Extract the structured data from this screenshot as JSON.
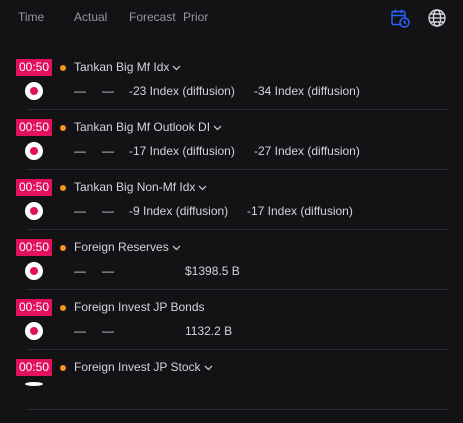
{
  "header": {
    "time": "Time",
    "actual": "Actual",
    "forecast": "Forecast",
    "prior": "Prior",
    "icons": [
      "calendar-clock-icon",
      "globe-icon"
    ],
    "accent": "#2962ff"
  },
  "colors": {
    "time_badge": "#e3115d",
    "importance_dot": "#f7931e",
    "flag": "#e3115d"
  },
  "events": [
    {
      "time": "00:50",
      "name": "Tankan Big Mf Idx",
      "actual": "—",
      "forecast": "—",
      "forecast_value": "-23 Index (diffusion)",
      "prior": "-34 Index (diffusion)"
    },
    {
      "time": "00:50",
      "name": "Tankan Big Mf Outlook DI",
      "actual": "—",
      "forecast": "—",
      "forecast_value": "-17 Index (diffusion)",
      "prior": "-27 Index (diffusion)"
    },
    {
      "time": "00:50",
      "name": "Tankan Big Non-Mf Idx",
      "actual": "—",
      "forecast": "—",
      "forecast_value": "-9 Index (diffusion)",
      "prior": "-17 Index (diffusion)"
    },
    {
      "time": "00:50",
      "name": "Foreign Reserves",
      "actual": "—",
      "forecast": "—",
      "prior": "$1398.5 B"
    },
    {
      "time": "00:50",
      "name": "Foreign Invest JP Bonds",
      "actual": "—",
      "forecast": "—",
      "prior": "1132.2 B"
    },
    {
      "time": "00:50",
      "name": "Foreign Invest JP Stock"
    }
  ]
}
